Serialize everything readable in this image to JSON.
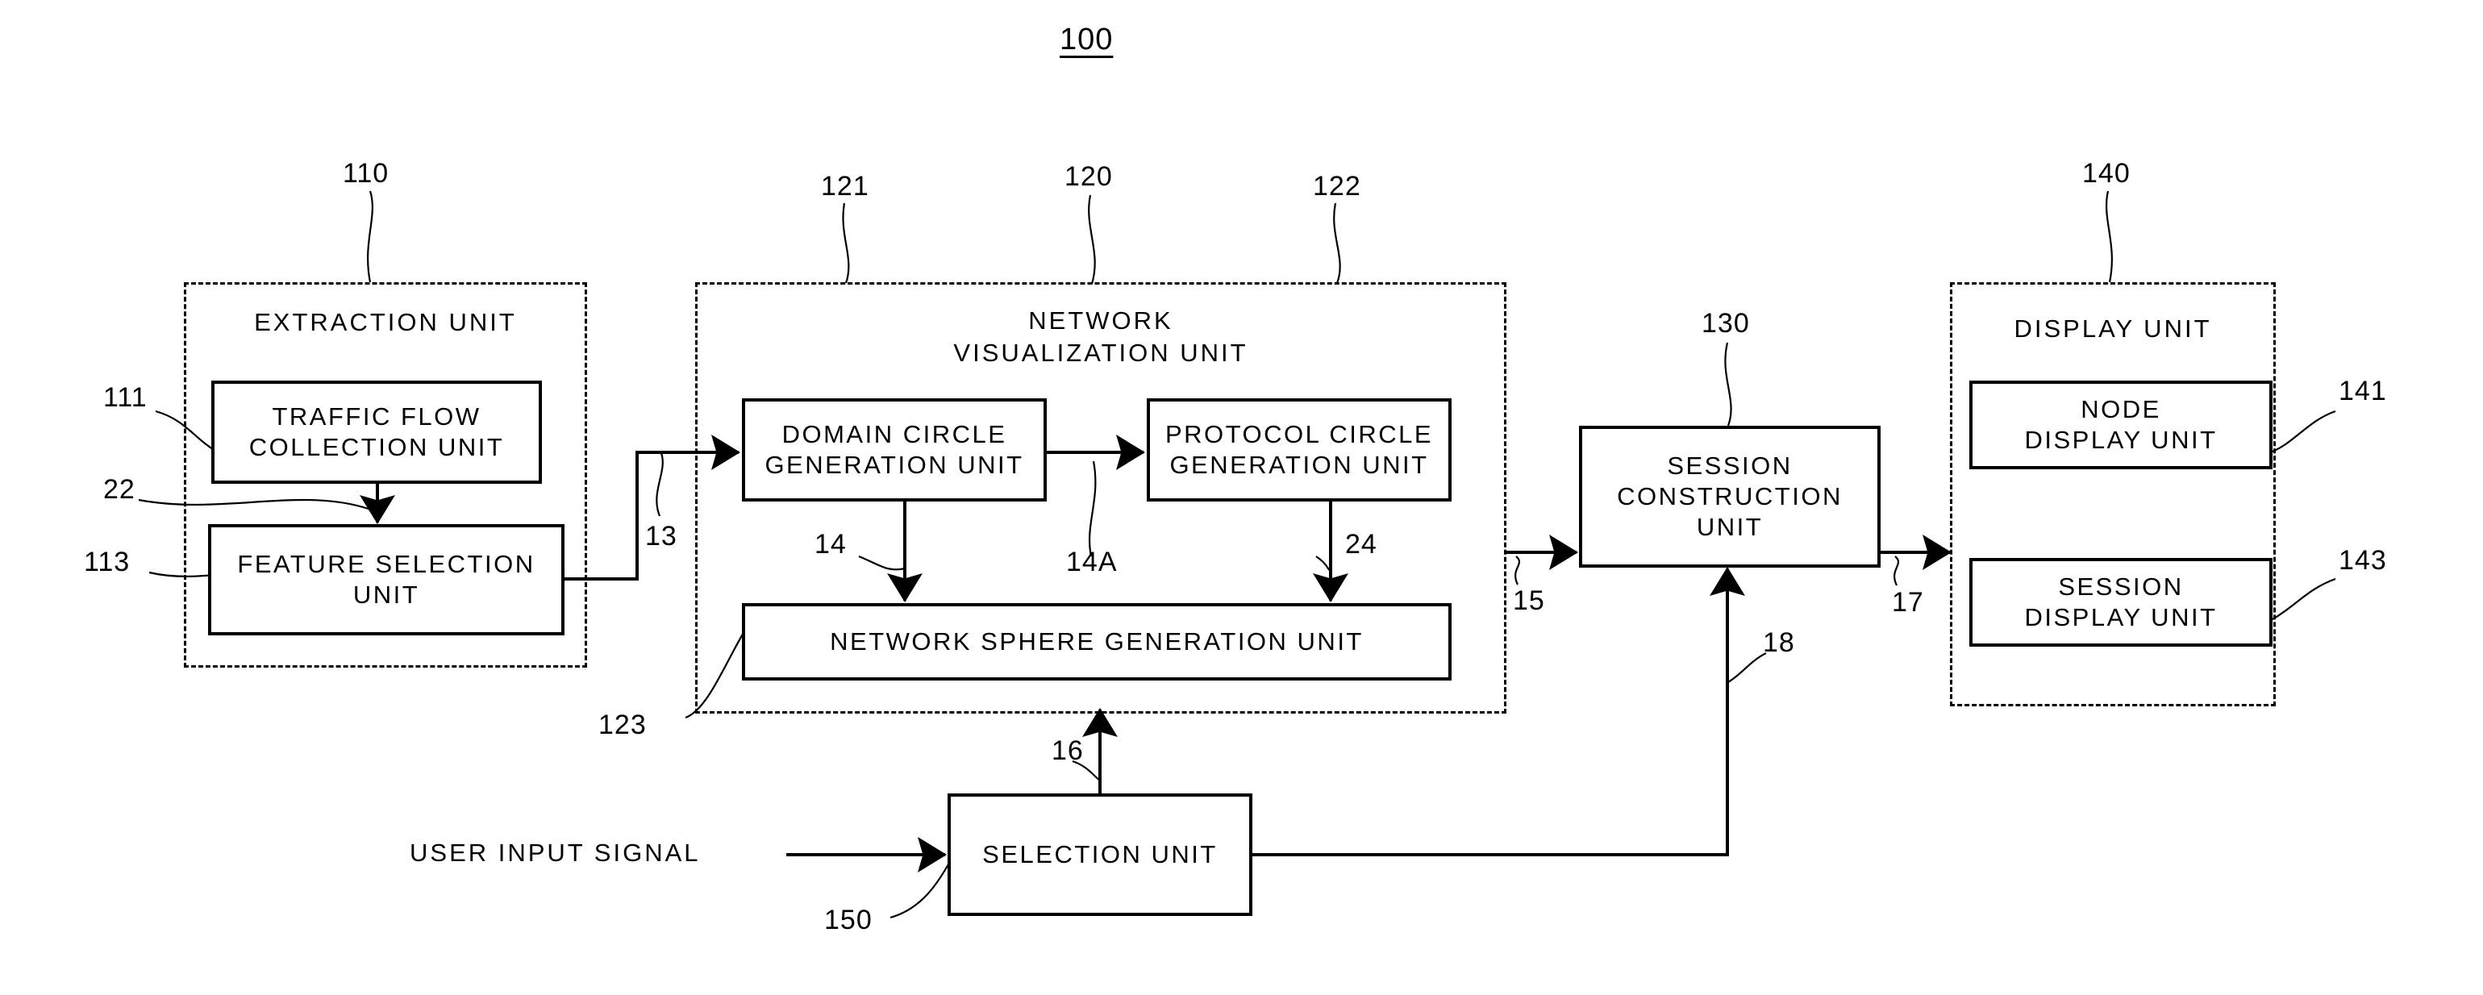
{
  "figure": {
    "top_reference": "100"
  },
  "groups": [
    {
      "id": "extraction-unit",
      "title": "EXTRACTION UNIT",
      "reference": "110"
    },
    {
      "id": "network-visualization-unit",
      "title": "NETWORK\nVISUALIZATION UNIT",
      "title_line1": "NETWORK",
      "title_line2": "VISUALIZATION UNIT",
      "reference": "120"
    },
    {
      "id": "display-unit",
      "title": "DISPLAY UNIT",
      "reference": "140"
    }
  ],
  "units": [
    {
      "id": "traffic-flow-collection-unit",
      "label": "TRAFFIC FLOW\nCOLLECTION UNIT",
      "reference": "111"
    },
    {
      "id": "feature-selection-unit",
      "label": "FEATURE SELECTION\nUNIT",
      "reference": "113"
    },
    {
      "id": "domain-circle-generation-unit",
      "label": "DOMAIN CIRCLE\nGENERATION UNIT",
      "reference": "121"
    },
    {
      "id": "protocol-circle-generation-unit",
      "label": "PROTOCOL CIRCLE\nGENERATION UNIT",
      "reference": "122"
    },
    {
      "id": "network-sphere-generation-unit",
      "label": "NETWORK SPHERE GENERATION UNIT",
      "reference": "123"
    },
    {
      "id": "session-construction-unit",
      "label": "SESSION\nCONSTRUCTION\nUNIT",
      "reference": "130"
    },
    {
      "id": "node-display-unit",
      "label": "NODE\nDISPLAY UNIT",
      "reference": "141"
    },
    {
      "id": "session-display-unit",
      "label": "SESSION\nDISPLAY UNIT",
      "reference": "143"
    },
    {
      "id": "selection-unit",
      "label": "SELECTION UNIT",
      "reference": "150"
    }
  ],
  "signals": {
    "user_input_signal": "USER INPUT SIGNAL"
  },
  "flow_references": {
    "traffic_to_feature": "22",
    "feature_to_domain": "13",
    "domain_to_sphere": "14",
    "domain_to_protocol": "14A",
    "protocol_to_sphere": "24",
    "visualization_to_session": "15",
    "selection_to_sphere": "16",
    "session_to_display": "17",
    "selection_to_session": "18"
  },
  "colors": {
    "line": "#000000",
    "background": "#ffffff"
  }
}
